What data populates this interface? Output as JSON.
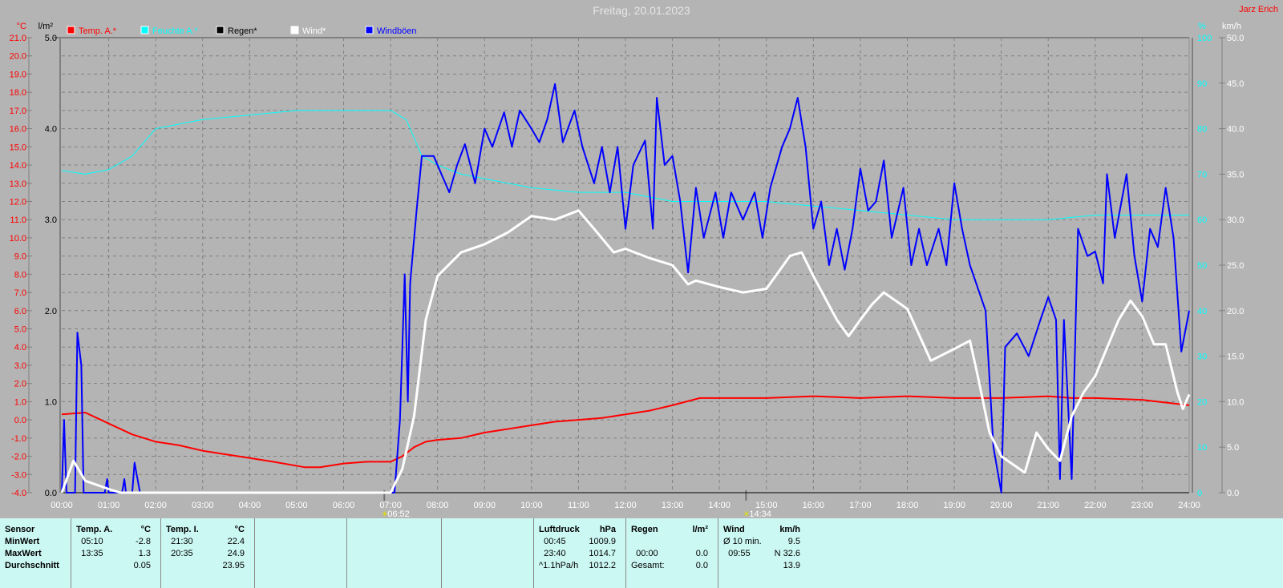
{
  "header": {
    "title": "Freitag, 20.01.2023",
    "author": "Jarz Erich"
  },
  "legend": [
    {
      "label": "Temp. A.*",
      "color": "#ff0000"
    },
    {
      "label": "Feuchte A.*",
      "color": "#00ffff"
    },
    {
      "label": "Regen*",
      "color": "#000000"
    },
    {
      "label": "Wind*",
      "color": "#ffffff"
    },
    {
      "label": "Windböen",
      "color": "#0000ff"
    }
  ],
  "chart_data": {
    "type": "line",
    "title": "Freitag, 20.01.2023",
    "x_ticks": [
      "00:00",
      "01:00",
      "02:00",
      "03:00",
      "04:00",
      "05:00",
      "06:00",
      "07:00",
      "08:00",
      "09:00",
      "10:00",
      "11:00",
      "12:00",
      "13:00",
      "14:00",
      "15:00",
      "16:00",
      "17:00",
      "18:00",
      "19:00",
      "20:00",
      "21:00",
      "22:00",
      "23:00",
      "24:00"
    ],
    "axes": {
      "temp": {
        "unit": "°C",
        "range": [
          -4,
          21
        ],
        "ticks": [
          "21.0",
          "20.0",
          "19.0",
          "18.0",
          "17.0",
          "16.0",
          "15.0",
          "14.0",
          "13.0",
          "12.0",
          "11.0",
          "10.0",
          "9.0",
          "8.0",
          "7.0",
          "6.0",
          "5.0",
          "4.0",
          "3.0",
          "2.0",
          "1.0",
          "0.0",
          "-1.0",
          "-2.0",
          "-3.0",
          "-4.0"
        ],
        "color": "#ff0000"
      },
      "rain": {
        "unit": "l/m²",
        "range": [
          0,
          5
        ],
        "ticks": [
          "5.0",
          "4.0",
          "3.0",
          "2.0",
          "1.0",
          "0.0"
        ],
        "color": "#000000"
      },
      "humidity": {
        "unit": "%",
        "range": [
          0,
          100
        ],
        "ticks": [
          "100",
          "90",
          "80",
          "70",
          "60",
          "50",
          "40",
          "30",
          "20",
          "10",
          "0"
        ],
        "color": "#00ffff"
      },
      "wind": {
        "unit": "km/h",
        "range": [
          0,
          50
        ],
        "ticks": [
          "50.0",
          "45.0",
          "40.0",
          "35.0",
          "30.0",
          "25.0",
          "20.0",
          "15.0",
          "10.0",
          "5.0",
          "0.0"
        ],
        "color": "#ffffff"
      }
    },
    "grid": true,
    "markers": [
      {
        "label": "06:52",
        "kind": "sunrise"
      },
      {
        "label": "14:34",
        "kind": "sunset"
      }
    ],
    "series": [
      {
        "name": "Temp. A.*",
        "axis": "temp",
        "color": "#ff0000",
        "points": [
          [
            "00:00",
            0.3
          ],
          [
            "00:30",
            0.4
          ],
          [
            "01:00",
            -0.2
          ],
          [
            "01:30",
            -0.8
          ],
          [
            "02:00",
            -1.2
          ],
          [
            "02:30",
            -1.4
          ],
          [
            "03:00",
            -1.7
          ],
          [
            "03:30",
            -1.9
          ],
          [
            "04:00",
            -2.1
          ],
          [
            "04:30",
            -2.3
          ],
          [
            "05:10",
            -2.6
          ],
          [
            "05:30",
            -2.6
          ],
          [
            "06:00",
            -2.4
          ],
          [
            "06:30",
            -2.3
          ],
          [
            "07:00",
            -2.3
          ],
          [
            "07:15",
            -2.0
          ],
          [
            "07:30",
            -1.5
          ],
          [
            "07:45",
            -1.2
          ],
          [
            "08:00",
            -1.1
          ],
          [
            "08:30",
            -1.0
          ],
          [
            "09:00",
            -0.7
          ],
          [
            "09:30",
            -0.5
          ],
          [
            "10:00",
            -0.3
          ],
          [
            "10:30",
            -0.1
          ],
          [
            "11:00",
            0.0
          ],
          [
            "11:30",
            0.1
          ],
          [
            "12:00",
            0.3
          ],
          [
            "12:30",
            0.5
          ],
          [
            "13:00",
            0.8
          ],
          [
            "13:35",
            1.2
          ],
          [
            "14:00",
            1.2
          ],
          [
            "15:00",
            1.2
          ],
          [
            "16:00",
            1.3
          ],
          [
            "17:00",
            1.2
          ],
          [
            "18:00",
            1.3
          ],
          [
            "19:00",
            1.2
          ],
          [
            "20:00",
            1.2
          ],
          [
            "21:00",
            1.3
          ],
          [
            "21:30",
            1.2
          ],
          [
            "22:00",
            1.2
          ],
          [
            "23:00",
            1.1
          ],
          [
            "24:00",
            0.8
          ]
        ]
      },
      {
        "name": "Feuchte A.*",
        "axis": "humidity",
        "color": "#00ffff",
        "points": [
          [
            "00:00",
            70.8
          ],
          [
            "00:30",
            70
          ],
          [
            "01:00",
            71
          ],
          [
            "01:30",
            74
          ],
          [
            "02:00",
            80
          ],
          [
            "02:30",
            81
          ],
          [
            "03:00",
            82
          ],
          [
            "04:00",
            83
          ],
          [
            "05:00",
            84
          ],
          [
            "06:00",
            84
          ],
          [
            "07:00",
            84
          ],
          [
            "07:20",
            82
          ],
          [
            "07:40",
            74
          ],
          [
            "08:00",
            72
          ],
          [
            "08:30",
            70
          ],
          [
            "09:00",
            69
          ],
          [
            "10:00",
            67
          ],
          [
            "11:00",
            66
          ],
          [
            "12:00",
            66
          ],
          [
            "13:00",
            64
          ],
          [
            "14:00",
            64
          ],
          [
            "15:00",
            64
          ],
          [
            "16:00",
            63
          ],
          [
            "17:00",
            62
          ],
          [
            "18:00",
            61
          ],
          [
            "19:00",
            60
          ],
          [
            "20:00",
            60
          ],
          [
            "21:00",
            60
          ],
          [
            "22:00",
            61
          ],
          [
            "23:00",
            61
          ],
          [
            "24:00",
            61
          ]
        ]
      },
      {
        "name": "Regen*",
        "axis": "rain",
        "color": "#000000",
        "points": [
          [
            "00:00",
            0
          ],
          [
            "24:00",
            0
          ]
        ]
      },
      {
        "name": "Wind*",
        "axis": "wind",
        "color": "#ffffff",
        "points": [
          [
            "00:00",
            0
          ],
          [
            "00:15",
            3.5
          ],
          [
            "00:30",
            1.3
          ],
          [
            "01:00",
            0.4
          ],
          [
            "01:15",
            0
          ],
          [
            "07:00",
            0
          ],
          [
            "07:15",
            2.6
          ],
          [
            "07:30",
            8.4
          ],
          [
            "07:45",
            19
          ],
          [
            "08:00",
            23.8
          ],
          [
            "08:30",
            26.4
          ],
          [
            "09:00",
            27.3
          ],
          [
            "09:30",
            28.6
          ],
          [
            "10:00",
            30.4
          ],
          [
            "10:30",
            30
          ],
          [
            "11:00",
            31
          ],
          [
            "11:20",
            29
          ],
          [
            "11:45",
            26.4
          ],
          [
            "12:00",
            26.8
          ],
          [
            "12:30",
            25.8
          ],
          [
            "13:00",
            25
          ],
          [
            "13:20",
            22.9
          ],
          [
            "13:30",
            23.3
          ],
          [
            "14:00",
            22.6
          ],
          [
            "14:30",
            22
          ],
          [
            "15:00",
            22.4
          ],
          [
            "15:30",
            26
          ],
          [
            "15:45",
            26.4
          ],
          [
            "16:00",
            23.8
          ],
          [
            "16:30",
            19
          ],
          [
            "16:45",
            17.2
          ],
          [
            "17:00",
            19
          ],
          [
            "17:15",
            20.7
          ],
          [
            "17:30",
            22
          ],
          [
            "17:45",
            21.1
          ],
          [
            "18:00",
            20.2
          ],
          [
            "18:30",
            14.5
          ],
          [
            "19:00",
            15.8
          ],
          [
            "19:20",
            16.7
          ],
          [
            "19:30",
            12.8
          ],
          [
            "19:45",
            6.6
          ],
          [
            "20:00",
            4
          ],
          [
            "20:30",
            2.2
          ],
          [
            "20:45",
            6.6
          ],
          [
            "21:00",
            4.8
          ],
          [
            "21:15",
            3.5
          ],
          [
            "21:30",
            8.4
          ],
          [
            "21:45",
            11
          ],
          [
            "22:00",
            12.8
          ],
          [
            "22:30",
            19
          ],
          [
            "22:45",
            21.1
          ],
          [
            "23:00",
            19.4
          ],
          [
            "23:15",
            16.3
          ],
          [
            "23:30",
            16.3
          ],
          [
            "23:45",
            11
          ],
          [
            "23:52",
            9.2
          ],
          [
            "24:00",
            10.8
          ]
        ]
      },
      {
        "name": "Windböen",
        "axis": "wind",
        "color": "#0000ff",
        "points": [
          [
            "00:00",
            0
          ],
          [
            "00:03",
            8
          ],
          [
            "00:06",
            0
          ],
          [
            "00:17",
            0
          ],
          [
            "00:20",
            17.6
          ],
          [
            "00:25",
            14
          ],
          [
            "00:28",
            0
          ],
          [
            "00:55",
            0
          ],
          [
            "00:58",
            1.5
          ],
          [
            "01:00",
            0
          ],
          [
            "01:17",
            0
          ],
          [
            "01:20",
            1.5
          ],
          [
            "01:22",
            0
          ],
          [
            "01:30",
            0
          ],
          [
            "01:33",
            3.3
          ],
          [
            "01:40",
            0
          ],
          [
            "07:05",
            0
          ],
          [
            "07:12",
            8
          ],
          [
            "07:18",
            24
          ],
          [
            "07:22",
            10
          ],
          [
            "07:25",
            23
          ],
          [
            "07:33",
            30.8
          ],
          [
            "07:40",
            37
          ],
          [
            "07:55",
            37
          ],
          [
            "08:05",
            35
          ],
          [
            "08:15",
            33
          ],
          [
            "08:25",
            36
          ],
          [
            "08:35",
            38.3
          ],
          [
            "08:48",
            34
          ],
          [
            "09:00",
            40
          ],
          [
            "09:10",
            38
          ],
          [
            "09:25",
            41.8
          ],
          [
            "09:35",
            38
          ],
          [
            "09:45",
            42
          ],
          [
            "10:00",
            40
          ],
          [
            "10:10",
            38.5
          ],
          [
            "10:20",
            41
          ],
          [
            "10:30",
            44.9
          ],
          [
            "10:40",
            38.5
          ],
          [
            "10:55",
            42
          ],
          [
            "11:05",
            38
          ],
          [
            "11:20",
            34
          ],
          [
            "11:30",
            38
          ],
          [
            "11:40",
            33
          ],
          [
            "11:50",
            38
          ],
          [
            "12:00",
            29
          ],
          [
            "12:10",
            36
          ],
          [
            "12:25",
            38.7
          ],
          [
            "12:35",
            29
          ],
          [
            "12:40",
            43.4
          ],
          [
            "12:50",
            36
          ],
          [
            "13:00",
            37
          ],
          [
            "13:10",
            32
          ],
          [
            "13:20",
            24.2
          ],
          [
            "13:30",
            33.5
          ],
          [
            "13:40",
            28
          ],
          [
            "13:55",
            33
          ],
          [
            "14:05",
            28
          ],
          [
            "14:15",
            33
          ],
          [
            "14:30",
            30
          ],
          [
            "14:45",
            33
          ],
          [
            "14:55",
            28
          ],
          [
            "15:05",
            33.5
          ],
          [
            "15:20",
            38
          ],
          [
            "15:30",
            40
          ],
          [
            "15:40",
            43.4
          ],
          [
            "15:50",
            38
          ],
          [
            "16:00",
            29
          ],
          [
            "16:10",
            32
          ],
          [
            "16:20",
            25
          ],
          [
            "16:30",
            29
          ],
          [
            "16:40",
            24.5
          ],
          [
            "16:50",
            29
          ],
          [
            "17:00",
            35.6
          ],
          [
            "17:10",
            31
          ],
          [
            "17:20",
            32
          ],
          [
            "17:30",
            36.5
          ],
          [
            "17:40",
            28
          ],
          [
            "17:55",
            33.5
          ],
          [
            "18:05",
            25
          ],
          [
            "18:15",
            29
          ],
          [
            "18:25",
            25
          ],
          [
            "18:40",
            29
          ],
          [
            "18:50",
            25
          ],
          [
            "19:00",
            34
          ],
          [
            "19:10",
            29
          ],
          [
            "19:20",
            25
          ],
          [
            "19:40",
            20
          ],
          [
            "19:50",
            5
          ],
          [
            "20:00",
            0
          ],
          [
            "20:05",
            16
          ],
          [
            "20:20",
            17.5
          ],
          [
            "20:35",
            15
          ],
          [
            "20:50",
            19
          ],
          [
            "21:00",
            21.5
          ],
          [
            "21:10",
            19
          ],
          [
            "21:15",
            1.5
          ],
          [
            "21:20",
            19
          ],
          [
            "21:30",
            1.5
          ],
          [
            "21:38",
            29
          ],
          [
            "21:50",
            26
          ],
          [
            "22:00",
            26.5
          ],
          [
            "22:10",
            23
          ],
          [
            "22:15",
            35
          ],
          [
            "22:25",
            28
          ],
          [
            "22:40",
            35
          ],
          [
            "22:50",
            26
          ],
          [
            "23:00",
            21
          ],
          [
            "23:10",
            29
          ],
          [
            "23:20",
            27
          ],
          [
            "23:30",
            33.5
          ],
          [
            "23:40",
            28
          ],
          [
            "23:50",
            15.5
          ],
          [
            "24:00",
            20
          ]
        ]
      }
    ]
  },
  "table": {
    "labels": {
      "header": "Sensor",
      "min": "MinWert",
      "max": "MaxWert",
      "avg": "Durchschnitt"
    },
    "temp_a": {
      "title": "Temp. A.",
      "unit": "°C",
      "min_time": "05:10",
      "min": "-2.8",
      "max_time": "13:35",
      "max": "1.3",
      "avg": "0.05"
    },
    "temp_i": {
      "title": "Temp. I.",
      "unit": "°C",
      "min_time": "21:30",
      "min": "22.4",
      "max_time": "20:35",
      "max": "24.9",
      "avg": "23.95"
    },
    "pressure": {
      "title": "Luftdruck",
      "unit": "hPa",
      "r1_label": "00:45",
      "r1": "1009.9",
      "r2_label": "23:40",
      "r2": "1014.7",
      "r3_label": "^1.1hPa/h",
      "r3": "1012.2"
    },
    "rain": {
      "title": "Regen",
      "unit": "l/m²",
      "r2_label": "00:00",
      "r2": "0.0",
      "r3_label": "Gesamt:",
      "r3": "0.0"
    },
    "wind": {
      "title": "Wind",
      "unit": "km/h",
      "r1_label": "Ø 10 min.",
      "r1": "9.5",
      "r2_label": "09:55",
      "r2": "N 32.6",
      "r3": "13.9"
    }
  }
}
